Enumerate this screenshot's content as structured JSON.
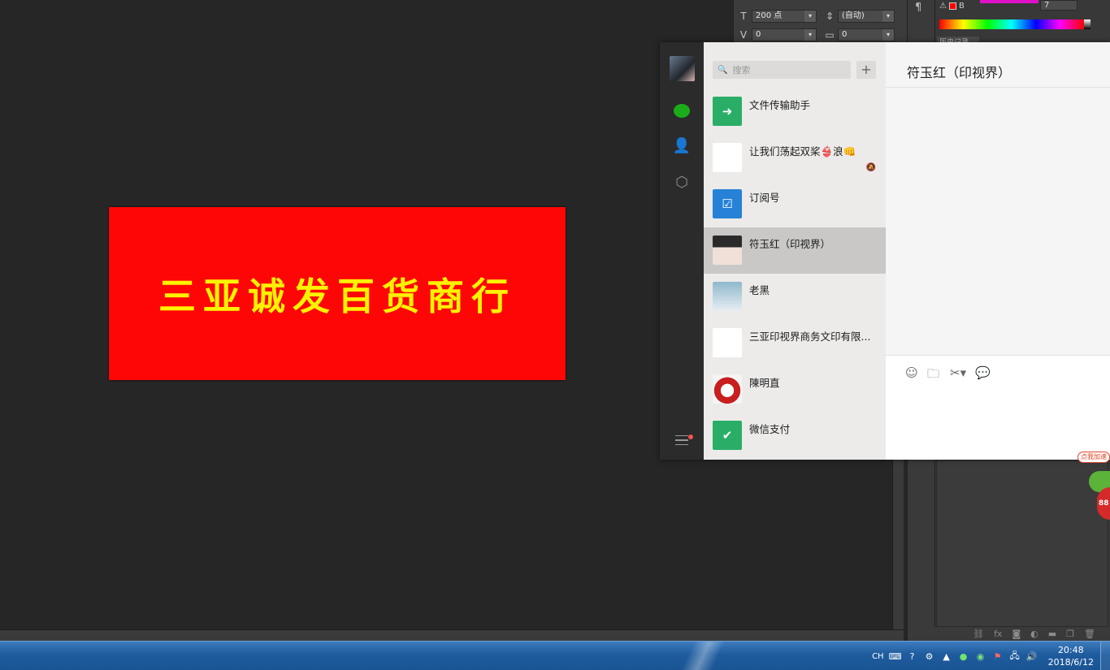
{
  "photoshop": {
    "banner_text": "三亚诚发百货商行",
    "char_panel": {
      "font_size": "200 点",
      "leading": "(自动)",
      "kerning": "0",
      "tracking": "0"
    },
    "pilcrow": "¶",
    "color_value": "7",
    "color_label": "B",
    "history_tab": "历史记录",
    "layer_bar_icons": [
      "link-icon",
      "fx-icon",
      "mask-icon",
      "adjustment-icon",
      "folder-icon",
      "new-layer-icon",
      "trash-icon"
    ]
  },
  "wechat": {
    "search_placeholder": "搜索",
    "add_label": "+",
    "chat_title": "符玉红（印视界）",
    "conversations": [
      {
        "name": "文件传输助手",
        "thumb": "file-transfer-icon",
        "color": "#2aae67"
      },
      {
        "name": "让我们荡起双桨👙浪👊",
        "thumb": "group-grid",
        "muted": true
      },
      {
        "name": "订阅号",
        "thumb": "subscription-icon",
        "color": "#2782d7"
      },
      {
        "name": "符玉红（印视界）",
        "thumb": "avatar",
        "active": true
      },
      {
        "name": "老黑",
        "thumb": "avatar"
      },
      {
        "name": "三亚印视界商务文印有限...",
        "thumb": "group-grid"
      },
      {
        "name": "陳明直",
        "thumb": "avatar"
      },
      {
        "name": "微信支付",
        "thumb": "wechat-pay-icon",
        "color": "#2aae67"
      }
    ],
    "toolbar_icons": [
      "emoji-icon",
      "folder-icon",
      "scissors-icon",
      "chat-history-icon"
    ]
  },
  "accelerator": {
    "badge": "点我加速",
    "number": "88"
  },
  "taskbar": {
    "lang": "CH",
    "time": "20:48",
    "date": "2018/6/12"
  },
  "colors": {
    "banner_bg": "#fe0606",
    "banner_text": "#fff200",
    "wechat_green": "#1aad19",
    "ps_bg": "#262626"
  }
}
